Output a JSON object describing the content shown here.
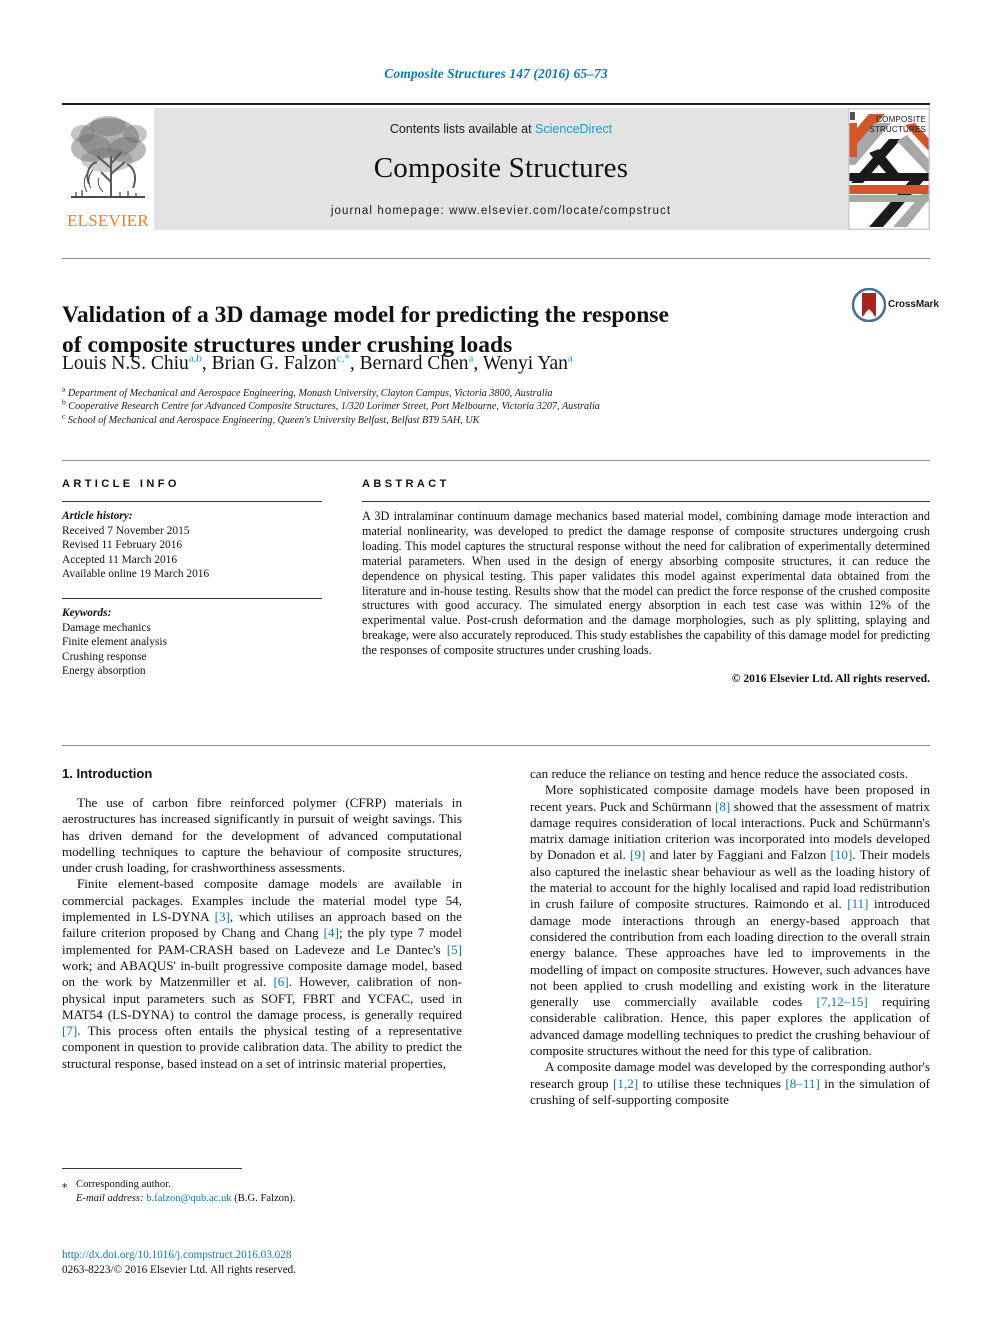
{
  "running_head": "Composite Structures 147 (2016) 65–73",
  "masthead": {
    "publisher_name": "ELSEVIER",
    "contents_prefix": "Contents lists available at ",
    "contents_link": "ScienceDirect",
    "journal_name": "Composite Structures",
    "homepage_label": "journal homepage: www.elsevier.com/locate/compstruct",
    "cover_title_line1": "COMPOSITE",
    "cover_title_line2": "STRUCTURES"
  },
  "article": {
    "title_line1": "Validation of a 3D damage model for predicting the response",
    "title_line2": "of composite structures under crushing loads",
    "crossmark_label": "CrossMark",
    "authors": [
      {
        "name": "Louis N.S. Chiu",
        "sup": "a,b",
        "sep": ", "
      },
      {
        "name": "Brian G. Falzon",
        "sup": "c,",
        "star": "*",
        "sep": ", "
      },
      {
        "name": "Bernard Chen",
        "sup": "a",
        "sep": ", "
      },
      {
        "name": "Wenyi Yan",
        "sup": "a",
        "sep": ""
      }
    ],
    "affiliations": [
      {
        "marker": "a",
        "text": "Department of Mechanical and Aerospace Engineering, Monash University, Clayton Campus, Victoria 3800, Australia"
      },
      {
        "marker": "b",
        "text": "Cooperative Research Centre for Advanced Composite Structures, 1/320 Lorimer Street, Port Melbourne, Victoria 3207, Australia"
      },
      {
        "marker": "c",
        "text": "School of Mechanical and Aerospace Engineering, Queen's University Belfast, Belfast BT9 5AH, UK"
      }
    ]
  },
  "article_info": {
    "heading": "ARTICLE INFO",
    "history_label": "Article history:",
    "history": [
      "Received 7 November 2015",
      "Revised 11 February 2016",
      "Accepted 11 March 2016",
      "Available online 19 March 2016"
    ],
    "keywords_label": "Keywords:",
    "keywords": [
      "Damage mechanics",
      "Finite element analysis",
      "Crushing response",
      "Energy absorption"
    ]
  },
  "abstract": {
    "heading": "ABSTRACT",
    "text": "A 3D intralaminar continuum damage mechanics based material model, combining damage mode interaction and material nonlinearity, was developed to predict the damage response of composite structures undergoing crush loading. This model captures the structural response without the need for calibration of experimentally determined material parameters. When used in the design of energy absorbing composite structures, it can reduce the dependence on physical testing. This paper validates this model against experimental data obtained from the literature and in-house testing. Results show that the model can predict the force response of the crushed composite structures with good accuracy. The simulated energy absorption in each test case was within 12% of the experimental value. Post-crush deformation and the damage morphologies, such as ply splitting, splaying and breakage, were also accurately reproduced. This study establishes the capability of this damage model for predicting the responses of composite structures under crushing loads.",
    "copyright": "© 2016 Elsevier Ltd. All rights reserved."
  },
  "body": {
    "section_heading": "1. Introduction",
    "left_paragraphs": [
      "The use of carbon fibre reinforced polymer (CFRP) materials in aerostructures has increased significantly in pursuit of weight savings. This has driven demand for the development of advanced computational modelling techniques to capture the behaviour of composite structures, under crush loading, for crashworthiness assessments.",
      "Finite element-based composite damage models are available in commercial packages. Examples include the material model type 54, implemented in LS-DYNA [3], which utilises an approach based on the failure criterion proposed by Chang and Chang [4]; the ply type 7 model implemented for PAM-CRASH based on Ladeveze and Le Dantec's [5] work; and ABAQUS' in-built progressive composite damage model, based on the work by Matzenmiller et al. [6]. However, calibration of non-physical input parameters such as SOFT, FBRT and YCFAC, used in MAT54 (LS-DYNA) to control the damage process, is generally required [7]. This process often entails the physical testing of a representative component in question to provide calibration data. The ability to predict the structural response, based instead on a set of intrinsic material properties,"
    ],
    "right_paragraphs": [
      "can reduce the reliance on testing and hence reduce the associated costs.",
      "More sophisticated composite damage models have been proposed in recent years. Puck and Schürmann [8] showed that the assessment of matrix damage requires consideration of local interactions. Puck and Schürmann's matrix damage initiation criterion was incorporated into models developed by Donadon et al. [9] and later by Faggiani and Falzon [10]. Their models also captured the inelastic shear behaviour as well as the loading history of the material to account for the highly localised and rapid load redistribution in crush failure of composite structures. Raimondo et al. [11] introduced damage mode interactions through an energy-based approach that considered the contribution from each loading direction to the overall strain energy balance. These approaches have led to improvements in the modelling of impact on composite structures. However, such advances have not been applied to crush modelling and existing work in the literature generally use commercially available codes [7,12–15] requiring considerable calibration. Hence, this paper explores the application of advanced damage modelling techniques to predict the crushing behaviour of composite structures without the need for this type of calibration.",
      "A composite damage model was developed by the corresponding author's research group [1,2] to utilise these techniques [8–11] in the simulation of crushing of self-supporting composite"
    ]
  },
  "footer": {
    "corresponding_marker": "⁎",
    "corresponding_label": "Corresponding author.",
    "email_label": "E-mail address:",
    "email": "b.falzon@qub.ac.uk",
    "email_owner": "(B.G. Falzon).",
    "doi_url": "http://dx.doi.org/10.1016/j.compstruct.2016.03.028",
    "issn_line": "0263-8223/© 2016 Elsevier Ltd. All rights reserved."
  },
  "colors": {
    "link": "#0b7bab",
    "sciencedirect": "#1c9ad6",
    "elsevier_orange": "#ef7d23",
    "band_gray": "#e3e3e3"
  }
}
